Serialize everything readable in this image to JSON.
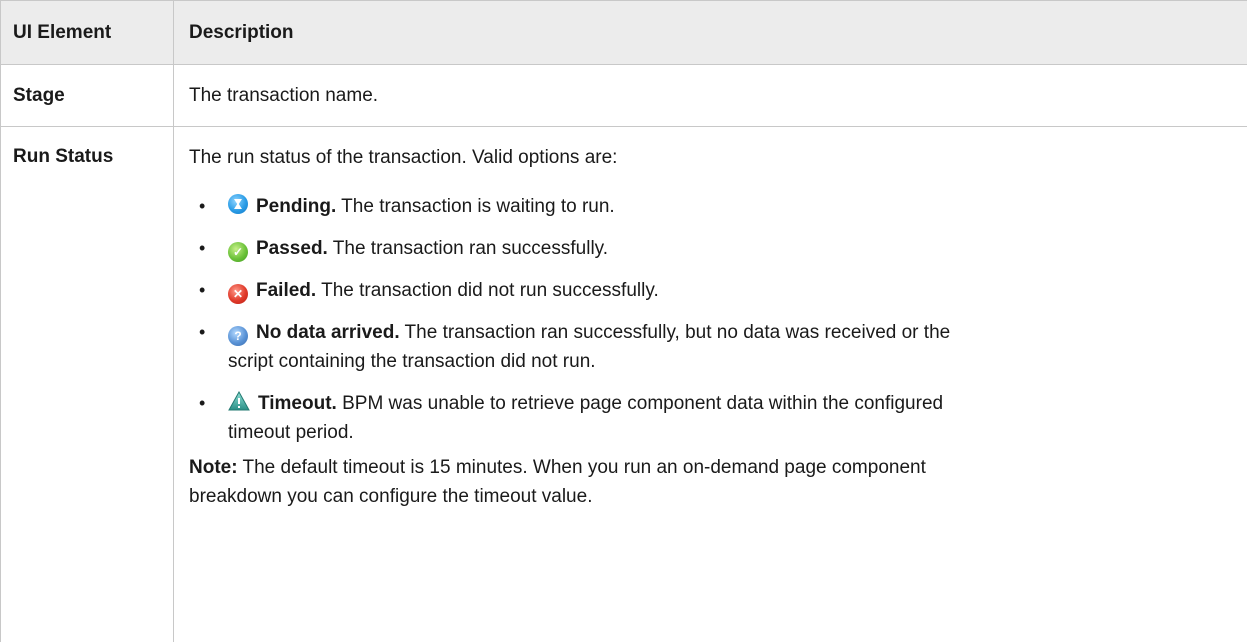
{
  "table": {
    "headers": [
      "UI Element",
      "Description"
    ],
    "rows": {
      "stage": {
        "element": "Stage",
        "description": "The transaction name."
      },
      "run_status": {
        "element": "Run Status",
        "intro": "The run status of the transaction. Valid options are:",
        "statuses": [
          {
            "icon": "pending-hourglass-icon",
            "name": "Pending.",
            "text": "The transaction is waiting to run."
          },
          {
            "icon": "passed-check-icon",
            "name": "Passed.",
            "text": "The transaction ran successfully."
          },
          {
            "icon": "failed-x-icon",
            "name": "Failed.",
            "text": "The transaction did not run successfully."
          },
          {
            "icon": "no-data-question-icon",
            "name": "No data arrived.",
            "text": "The transaction ran successfully, but no data was received or the",
            "text2": "script containing the transaction did not run."
          },
          {
            "icon": "timeout-warning-icon",
            "name": "Timeout.",
            "text": "BPM was unable to retrieve page component data within the configured",
            "text2": "timeout period."
          }
        ],
        "note_label": "Note:",
        "note_text": "The default timeout is 15 minutes. When you run an on-demand page component",
        "note_text2": "breakdown you can configure the timeout value."
      }
    }
  },
  "colors": {
    "header_bg": "#ececec",
    "border": "#c8c8c8",
    "pending": "#2a9ce6",
    "passed": "#6cc23a",
    "failed": "#e03a2a",
    "no_data": "#5a93d6",
    "timeout": "#3aa9a0"
  }
}
